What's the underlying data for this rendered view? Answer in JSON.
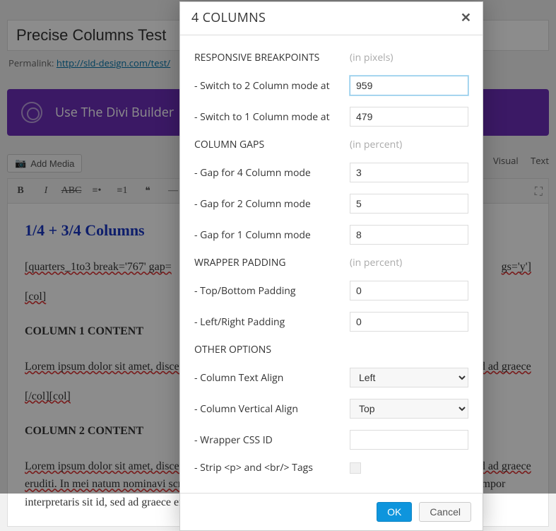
{
  "page": {
    "title": "Precise Columns Test",
    "permalink_label": "Permalink:",
    "permalink_url": "http://sld-design.com/test/",
    "divi_label": "Use The Divi Builder",
    "add_media_label": "Add Media",
    "tabs": {
      "visual": "Visual",
      "text": "Text"
    }
  },
  "editor": {
    "heading": "1/4 + 3/4 Columns",
    "shortcode_open": "[quarters_1to3 break='767' gap=",
    "shortcode_tail": "gs='y']",
    "col_open": "[col]",
    "col1_h": "COLUMN 1 CONTENT",
    "col1_p": "Lorem ipsum dolor sit amet, discere fabellas nec at. Ut amet nostro vis, tempor interpretaris sit id, sed ad graece",
    "col_close_open": "[/col][col]",
    "col2_h": "COLUMN 2 CONTENT",
    "col2_p": "Lorem ipsum dolor sit amet, discere fabellas nec at. Ut amet nostro vis, tempor interpretaris sit id, sed ad graece eruditi. In mei natum nominavi scripserit. Sint vitae vel at, adhuc illum",
    "col2_tail": " duo an. Ut amet nostro vis, tempor interpretaris sit id, sed ad graece eruditi."
  },
  "modal": {
    "title": "4 COLUMNS",
    "sections": {
      "breakpoints": {
        "label": "RESPONSIVE BREAKPOINTS",
        "unit": "(in pixels)"
      },
      "gaps": {
        "label": "COLUMN GAPS",
        "unit": "(in percent)"
      },
      "padding": {
        "label": "WRAPPER PADDING",
        "unit": "(in percent)"
      },
      "other": {
        "label": "OTHER OPTIONS"
      }
    },
    "fields": {
      "switch2": {
        "label": "- Switch to 2 Column mode at",
        "value": "959"
      },
      "switch1": {
        "label": "- Switch to 1 Column mode at",
        "value": "479"
      },
      "gap4": {
        "label": "- Gap for 4 Column mode",
        "value": "3"
      },
      "gap2": {
        "label": "- Gap for 2 Column mode",
        "value": "5"
      },
      "gap1": {
        "label": "- Gap for 1 Column mode",
        "value": "8"
      },
      "pad_tb": {
        "label": "- Top/Bottom Padding",
        "value": "0"
      },
      "pad_lr": {
        "label": "- Left/Right Padding",
        "value": "0"
      },
      "align": {
        "label": "- Column Text Align",
        "value": "Left"
      },
      "valign": {
        "label": "- Column Vertical Align",
        "value": "Top"
      },
      "css_id": {
        "label": "- Wrapper CSS ID",
        "value": ""
      },
      "strip": {
        "label": "- Strip <p> and <br/> Tags"
      }
    },
    "buttons": {
      "ok": "OK",
      "cancel": "Cancel"
    }
  }
}
